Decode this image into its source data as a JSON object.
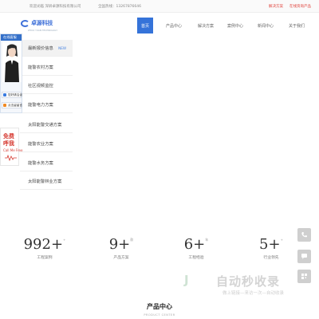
{
  "topbar": {
    "welcome": "欢迎光临 深圳卓源科技有限公司",
    "hotline": "全国热线：13267876646",
    "link1": "解决方案",
    "link2": "在线资询产品"
  },
  "logo": {
    "name": "卓源科技",
    "tagline": "ZHUO YUAN TECHNOLOGY"
  },
  "nav": {
    "items": [
      {
        "label": "首页",
        "active": true
      },
      {
        "label": "产品中心"
      },
      {
        "label": "解决方案"
      },
      {
        "label": "案例中心"
      },
      {
        "label": "新闻中心"
      },
      {
        "label": "关于我们"
      }
    ]
  },
  "chat": {
    "header": "在线客服",
    "btn1": "您好请洽谈",
    "btn2": "点击留留言"
  },
  "call": {
    "line1": "免费",
    "line2": "呼我",
    "line3": "Call Me Free"
  },
  "menu": {
    "items": [
      {
        "label": "最新报价信息",
        "badge": "NEW"
      },
      {
        "label": "能警农村方案"
      },
      {
        "label": "社区视频监控"
      },
      {
        "label": "能警电力方案"
      },
      {
        "label": "太阳能警交通方案"
      },
      {
        "label": "能警农业方案"
      },
      {
        "label": "能警水务方案"
      },
      {
        "label": "太阳能警林业方案"
      }
    ]
  },
  "stats": [
    {
      "number": "992+",
      "unit": "+",
      "label": "工程案例"
    },
    {
      "number": "9+",
      "unit": "款",
      "label": "产品方案"
    },
    {
      "number": "6+",
      "unit": "年",
      "label": "工程经验"
    },
    {
      "number": "5+",
      "unit": "+",
      "label": "行业领先"
    }
  ],
  "watermark": {
    "brand": "自动秒收录",
    "sub": "做上链接—来访一次—自动收录"
  },
  "section": {
    "title": "产品中心",
    "subtitle": "PRODUCT CENTER"
  },
  "colors": {
    "accent": "#3573d9",
    "red": "#d63a31"
  }
}
